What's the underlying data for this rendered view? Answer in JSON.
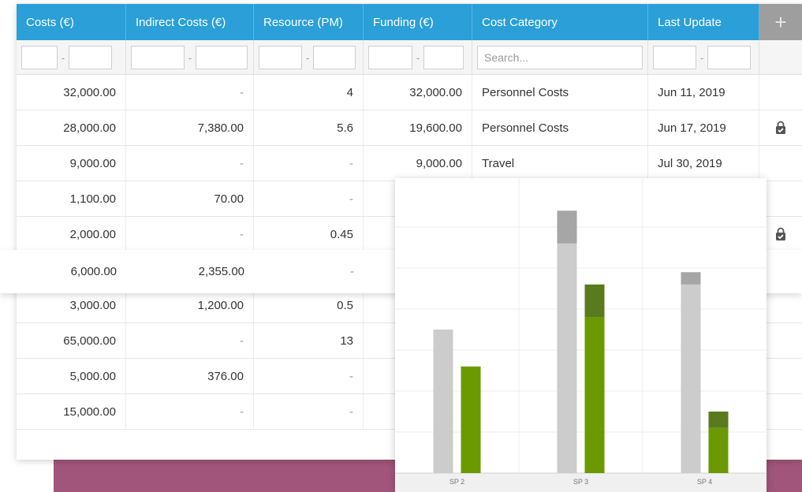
{
  "table": {
    "headers": [
      "Costs (€)",
      "Indirect Costs (€)",
      "Resource (PM)",
      "Funding (€)",
      "Cost Category",
      "Last Update"
    ],
    "add_column_label": "+",
    "filter": {
      "range_separator": "-",
      "search_placeholder": "Search..."
    },
    "rows": [
      {
        "costs": "32,000.00",
        "indirect": "-",
        "resource": "4",
        "funding": "32,000.00",
        "category": "Personnel Costs",
        "updated": "Jun 11, 2019",
        "locked": false
      },
      {
        "costs": "28,000.00",
        "indirect": "7,380.00",
        "resource": "5.6",
        "funding": "19,600.00",
        "category": "Personnel Costs",
        "updated": "Jun 17, 2019",
        "locked": true
      },
      {
        "costs": "9,000.00",
        "indirect": "-",
        "resource": "-",
        "funding": "9,000.00",
        "category": "Travel",
        "updated": "Jul 30, 2019",
        "locked": false
      },
      {
        "costs": "1,100.00",
        "indirect": "70.00",
        "resource": "-",
        "funding": "",
        "category": "",
        "updated": "",
        "locked": false
      },
      {
        "costs": "2,000.00",
        "indirect": "-",
        "resource": "0.45",
        "funding": "",
        "category": "",
        "updated": "",
        "locked": true
      },
      {
        "costs": "6,000.00",
        "indirect": "2,355.00",
        "resource": "-",
        "funding": "",
        "category": "",
        "updated": "",
        "locked": false
      },
      {
        "costs": "3,000.00",
        "indirect": "1,200.00",
        "resource": "0.5",
        "funding": "",
        "category": "",
        "updated": "",
        "locked": false
      },
      {
        "costs": "65,000.00",
        "indirect": "-",
        "resource": "13",
        "funding": "",
        "category": "",
        "updated": "",
        "locked": false
      },
      {
        "costs": "5,000.00",
        "indirect": "376.00",
        "resource": "-",
        "funding": "",
        "category": "",
        "updated": "",
        "locked": false
      },
      {
        "costs": "15,000.00",
        "indirect": "-",
        "resource": "-",
        "funding": "",
        "category": "",
        "updated": "",
        "locked": false
      }
    ]
  },
  "colors": {
    "header_blue": "#2a9fd8",
    "header_grey": "#9e9e9e",
    "bar_grey": "#cccccc",
    "bar_grey_dark": "#a6a6a6",
    "bar_green": "#6a9a00",
    "bar_green_dark": "#5a7a1e",
    "purple_band": "#a1557a"
  },
  "chart_data": {
    "type": "bar",
    "categories": [
      "SP 2",
      "SP 3",
      "SP 4"
    ],
    "ylim": [
      0,
      7
    ],
    "series": [
      {
        "values": [
          3.5,
          5.6,
          4.6
        ],
        "color": "#cccccc",
        "stack_top": [
          0,
          0.8,
          0.3
        ],
        "stack_top_color": "#a6a6a6"
      },
      {
        "values": [
          2.6,
          3.8,
          1.1
        ],
        "color": "#6a9a00",
        "stack_top": [
          0,
          0.8,
          0.4
        ],
        "stack_top_color": "#5a7a1e"
      }
    ],
    "grid": true
  }
}
